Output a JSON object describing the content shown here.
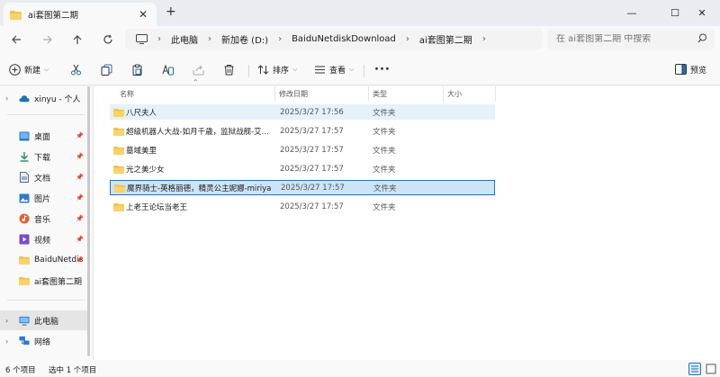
{
  "window": {
    "tab_title": "ai套图第二期",
    "tab_close": "✕",
    "new_tab": "+",
    "controls": {
      "minimize": "—",
      "maximize": "☐",
      "close": "✕"
    }
  },
  "nav": {
    "breadcrumbs": [
      "此电脑",
      "新加卷 (D:)",
      "BaiduNetdiskDownload",
      "ai套图第二期"
    ],
    "separator": "›",
    "search_placeholder": "在 ai套图第二期 中搜索"
  },
  "toolbar": {
    "new_label": "新建",
    "sort_label": "排序",
    "view_label": "查看",
    "more_label": "···",
    "preview_label": "预览"
  },
  "sidebar": {
    "user_item": "xinyu - 个人",
    "quick": [
      {
        "label": "桌面",
        "icon": "desktop-icon"
      },
      {
        "label": "下载",
        "icon": "download-icon"
      },
      {
        "label": "文档",
        "icon": "document-icon"
      },
      {
        "label": "图片",
        "icon": "pictures-icon"
      },
      {
        "label": "音乐",
        "icon": "music-icon"
      },
      {
        "label": "视频",
        "icon": "video-icon"
      },
      {
        "label": "BaiduNetdis",
        "icon": "folder-icon"
      },
      {
        "label": "ai套图第二期",
        "icon": "folder-icon"
      }
    ],
    "this_pc": "此电脑",
    "network": "网络"
  },
  "columns": {
    "name": "名称",
    "date": "修改日期",
    "type": "类型",
    "size": "大小"
  },
  "files": [
    {
      "name": "八尺夫人",
      "date": "2025/3/27 17:56",
      "type": "文件夹",
      "state": "hover"
    },
    {
      "name": "超级机器人大战-如月千歳，监狱战舰-艾...",
      "date": "2025/3/27 17:57",
      "type": "文件夹",
      "state": ""
    },
    {
      "name": "墓域美里",
      "date": "2025/3/27 17:57",
      "type": "文件夹",
      "state": ""
    },
    {
      "name": "光之美少女",
      "date": "2025/3/27 17:57",
      "type": "文件夹",
      "state": ""
    },
    {
      "name": "魔界骑士-英格丽德，精灵公主妮娜-miriya",
      "date": "2025/3/27 17:57",
      "type": "文件夹",
      "state": "selected"
    },
    {
      "name": "上老王论坛当老王",
      "date": "2025/3/27 17:57",
      "type": "文件夹",
      "state": ""
    }
  ],
  "status": {
    "count": "6 个项目",
    "selected": "选中 1 个项目"
  },
  "colors": {
    "folder": "#f2c14e",
    "accent": "#2a6fbd",
    "selected_bg": "#cce4f7",
    "hover_bg": "#e5f1fb"
  }
}
